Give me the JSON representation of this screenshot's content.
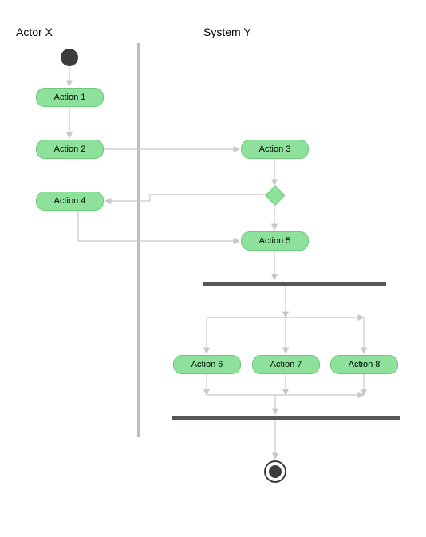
{
  "type": "uml-activity-diagram",
  "lanes": {
    "actor": "Actor X",
    "system": "System Y"
  },
  "activities": {
    "a1": "Action 1",
    "a2": "Action 2",
    "a3": "Action 3",
    "a4": "Action 4",
    "a5": "Action 5",
    "a6": "Action 6",
    "a7": "Action 7",
    "a8": "Action 8"
  },
  "chart_data": {
    "type": "activity-diagram",
    "swimlanes": [
      "Actor X",
      "System Y"
    ],
    "nodes": [
      {
        "id": "initial",
        "kind": "initial",
        "lane": "Actor X"
      },
      {
        "id": "a1",
        "kind": "activity",
        "lane": "Actor X",
        "label": "Action 1"
      },
      {
        "id": "a2",
        "kind": "activity",
        "lane": "Actor X",
        "label": "Action 2"
      },
      {
        "id": "a3",
        "kind": "activity",
        "lane": "System Y",
        "label": "Action 3"
      },
      {
        "id": "decision",
        "kind": "decision",
        "lane": "System Y"
      },
      {
        "id": "a4",
        "kind": "activity",
        "lane": "Actor X",
        "label": "Action 4"
      },
      {
        "id": "a5",
        "kind": "activity",
        "lane": "System Y",
        "label": "Action 5"
      },
      {
        "id": "fork",
        "kind": "fork",
        "lane": "System Y"
      },
      {
        "id": "a6",
        "kind": "activity",
        "lane": "System Y",
        "label": "Action 6"
      },
      {
        "id": "a7",
        "kind": "activity",
        "lane": "System Y",
        "label": "Action 7"
      },
      {
        "id": "a8",
        "kind": "activity",
        "lane": "System Y",
        "label": "Action 8"
      },
      {
        "id": "join",
        "kind": "join",
        "lane": "System Y"
      },
      {
        "id": "final",
        "kind": "final",
        "lane": "System Y"
      }
    ],
    "edges": [
      {
        "from": "initial",
        "to": "a1"
      },
      {
        "from": "a1",
        "to": "a2"
      },
      {
        "from": "a2",
        "to": "a3"
      },
      {
        "from": "a3",
        "to": "decision"
      },
      {
        "from": "decision",
        "to": "a4"
      },
      {
        "from": "decision",
        "to": "a5"
      },
      {
        "from": "a4",
        "to": "a5"
      },
      {
        "from": "a5",
        "to": "fork"
      },
      {
        "from": "fork",
        "to": "a6"
      },
      {
        "from": "fork",
        "to": "a7"
      },
      {
        "from": "fork",
        "to": "a8"
      },
      {
        "from": "a6",
        "to": "join"
      },
      {
        "from": "a7",
        "to": "join"
      },
      {
        "from": "a8",
        "to": "join"
      },
      {
        "from": "join",
        "to": "final"
      }
    ]
  }
}
